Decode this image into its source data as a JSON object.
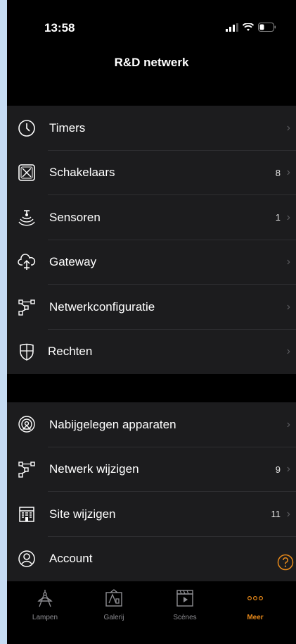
{
  "status": {
    "time": "13:58"
  },
  "header": {
    "title": "R&D netwerk"
  },
  "group1": {
    "items": [
      {
        "label": "Timers",
        "count": ""
      },
      {
        "label": "Schakelaars",
        "count": "8"
      },
      {
        "label": "Sensoren",
        "count": "1"
      },
      {
        "label": "Gateway",
        "count": ""
      },
      {
        "label": "Netwerkconfiguratie",
        "count": ""
      },
      {
        "label": "Rechten",
        "count": ""
      }
    ]
  },
  "group2": {
    "items": [
      {
        "label": "Nabijgelegen apparaten",
        "count": ""
      },
      {
        "label": "Netwerk wijzigen",
        "count": "9"
      },
      {
        "label": "Site wijzigen",
        "count": "11"
      },
      {
        "label": "Account",
        "count": ""
      }
    ]
  },
  "tabs": [
    {
      "label": "Lampen"
    },
    {
      "label": "Galerij"
    },
    {
      "label": "Scènes"
    },
    {
      "label": "Meer"
    }
  ],
  "colors": {
    "accent": "#e98a1a",
    "background": "#000000",
    "cell": "#1c1c1e"
  }
}
